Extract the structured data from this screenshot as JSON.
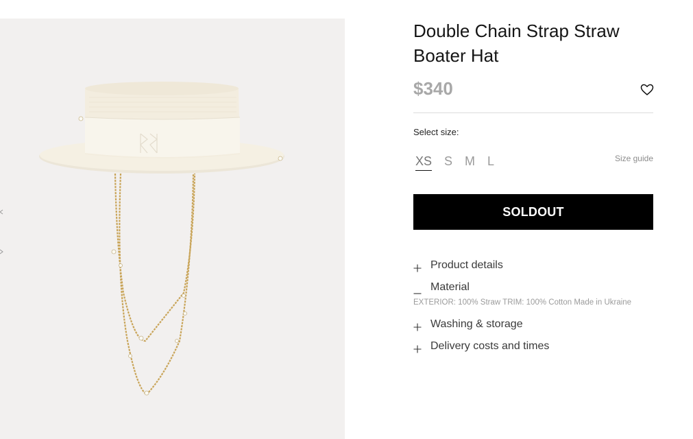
{
  "product": {
    "title": "Double Chain Strap Straw Boater Hat",
    "price": "$340",
    "image_alt": "straw boater hat with double chain strap"
  },
  "size_selector": {
    "label": "Select size:",
    "options": [
      "XS",
      "S",
      "M",
      "L"
    ],
    "selected": "XS",
    "guide_label": "Size guide"
  },
  "actions": {
    "soldout_label": "SOLDOUT"
  },
  "accordion": [
    {
      "label": "Product details",
      "expanded": false,
      "icon": "plus-icon"
    },
    {
      "label": "Material",
      "expanded": true,
      "icon": "minus-icon",
      "content": "EXTERIOR: 100% Straw TRIM: 100% Cotton Made in Ukraine"
    },
    {
      "label": "Washing & storage",
      "expanded": false,
      "icon": "plus-icon"
    },
    {
      "label": "Delivery costs and times",
      "expanded": false,
      "icon": "plus-icon"
    }
  ],
  "icons": {
    "wishlist": "heart-outline-icon",
    "gallery_prev": "chevron-left-icon"
  },
  "colors": {
    "image_background": "#f2f0ef",
    "price": "#a8a8a8",
    "button_background": "#000000",
    "button_text": "#ffffff",
    "divider": "#dcdcdc"
  }
}
